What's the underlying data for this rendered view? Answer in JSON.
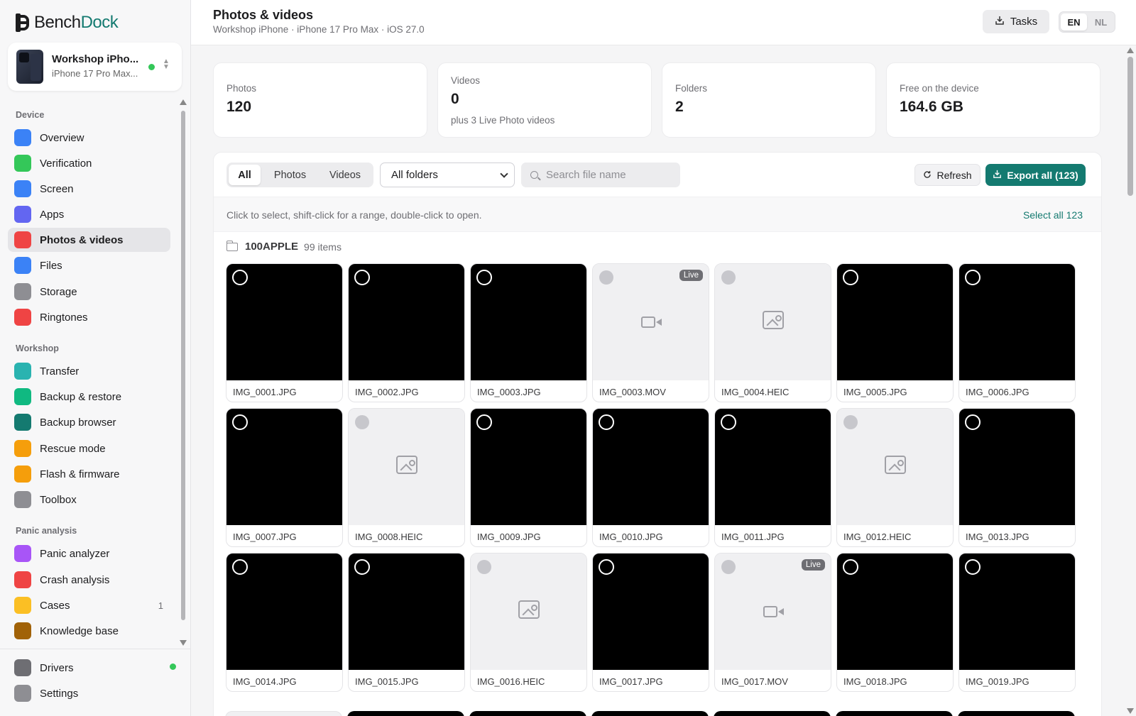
{
  "brand": {
    "part1": "Bench",
    "part2": "Dock",
    "accent": "#147a70"
  },
  "device": {
    "name": "Workshop iPho...",
    "model": "iPhone 17 Pro Max...",
    "status_color": "#34c759"
  },
  "sidebar": {
    "sections": [
      "Device",
      "Workshop",
      "Panic analysis"
    ],
    "items": [
      {
        "label": "Overview",
        "icon": "phone-icon",
        "color": "#3b82f6"
      },
      {
        "label": "Verification",
        "icon": "shield-check-icon",
        "color": "#34c759"
      },
      {
        "label": "Screen",
        "icon": "screen-icon",
        "color": "#3b82f6"
      },
      {
        "label": "Apps",
        "icon": "apps-grid-icon",
        "color": "#6366f1"
      },
      {
        "label": "Photos & videos",
        "icon": "photos-icon",
        "color": "#ef4444",
        "active": true
      },
      {
        "label": "Files",
        "icon": "folder-icon",
        "color": "#3b82f6"
      },
      {
        "label": "Storage",
        "icon": "storage-pie-icon",
        "color": "#8e8e93"
      },
      {
        "label": "Ringtones",
        "icon": "music-note-icon",
        "color": "#ef4444"
      },
      {
        "label": "Transfer",
        "icon": "transfer-arrows-icon",
        "color": "#2ab3b0"
      },
      {
        "label": "Backup & restore",
        "icon": "backup-icon",
        "color": "#10b981"
      },
      {
        "label": "Backup browser",
        "icon": "archive-icon",
        "color": "#147a70"
      },
      {
        "label": "Rescue mode",
        "icon": "lifebuoy-icon",
        "color": "#f59e0b"
      },
      {
        "label": "Flash & firmware",
        "icon": "chip-icon",
        "color": "#f59e0b"
      },
      {
        "label": "Toolbox",
        "icon": "wrench-icon",
        "color": "#8e8e93"
      },
      {
        "label": "Panic analyzer",
        "icon": "waveform-icon",
        "color": "#a855f7"
      },
      {
        "label": "Crash analysis",
        "icon": "graph-icon",
        "color": "#ef4444"
      },
      {
        "label": "Cases",
        "icon": "case-icon",
        "color": "#fbbf24",
        "badge": "1"
      },
      {
        "label": "Knowledge base",
        "icon": "book-icon",
        "color": "#a16207"
      }
    ],
    "footer": [
      {
        "label": "Drivers",
        "icon": "puzzle-icon",
        "color": "#6e6e73"
      },
      {
        "label": "Settings",
        "icon": "gear-icon",
        "color": "#8e8e93"
      }
    ]
  },
  "header": {
    "title": "Photos & videos",
    "subtitle": "Workshop iPhone · iPhone 17 Pro Max · iOS 27.0",
    "tasks_label": "Tasks",
    "lang_en": "EN",
    "lang_nl": "NL"
  },
  "stats": [
    {
      "label": "Photos",
      "value": "120"
    },
    {
      "label": "Videos",
      "value": "0",
      "sub": "plus 3 Live Photo videos"
    },
    {
      "label": "Folders",
      "value": "2"
    },
    {
      "label": "Free on the device",
      "value": "164.6 GB"
    }
  ],
  "toolbar": {
    "filters": [
      "All",
      "Photos",
      "Videos"
    ],
    "active_filter": "All",
    "folder_select": "All folders",
    "search_placeholder": "Search file name",
    "refresh_label": "Refresh",
    "export_label": "Export all (123)"
  },
  "hint": {
    "text": "Click to select, shift-click for a range, double-click to open.",
    "select_all": "Select all 123"
  },
  "folder": {
    "name": "100APPLE",
    "count": "99 items"
  },
  "files": [
    {
      "name": "IMG_0001.JPG",
      "kind": "image"
    },
    {
      "name": "IMG_0002.JPG",
      "kind": "image"
    },
    {
      "name": "IMG_0003.JPG",
      "kind": "image"
    },
    {
      "name": "IMG_0003.MOV",
      "kind": "video",
      "live": "Live"
    },
    {
      "name": "IMG_0004.HEIC",
      "kind": "heic"
    },
    {
      "name": "IMG_0005.JPG",
      "kind": "image"
    },
    {
      "name": "IMG_0006.JPG",
      "kind": "image"
    },
    {
      "name": "IMG_0007.JPG",
      "kind": "image"
    },
    {
      "name": "IMG_0008.HEIC",
      "kind": "heic"
    },
    {
      "name": "IMG_0009.JPG",
      "kind": "image"
    },
    {
      "name": "IMG_0010.JPG",
      "kind": "image"
    },
    {
      "name": "IMG_0011.JPG",
      "kind": "image"
    },
    {
      "name": "IMG_0012.HEIC",
      "kind": "heic"
    },
    {
      "name": "IMG_0013.JPG",
      "kind": "image"
    },
    {
      "name": "IMG_0014.JPG",
      "kind": "image"
    },
    {
      "name": "IMG_0015.JPG",
      "kind": "image"
    },
    {
      "name": "IMG_0016.HEIC",
      "kind": "heic"
    },
    {
      "name": "IMG_0017.JPG",
      "kind": "image"
    },
    {
      "name": "IMG_0017.MOV",
      "kind": "video",
      "live": "Live"
    },
    {
      "name": "IMG_0018.JPG",
      "kind": "image"
    },
    {
      "name": "IMG_0019.JPG",
      "kind": "image"
    }
  ]
}
